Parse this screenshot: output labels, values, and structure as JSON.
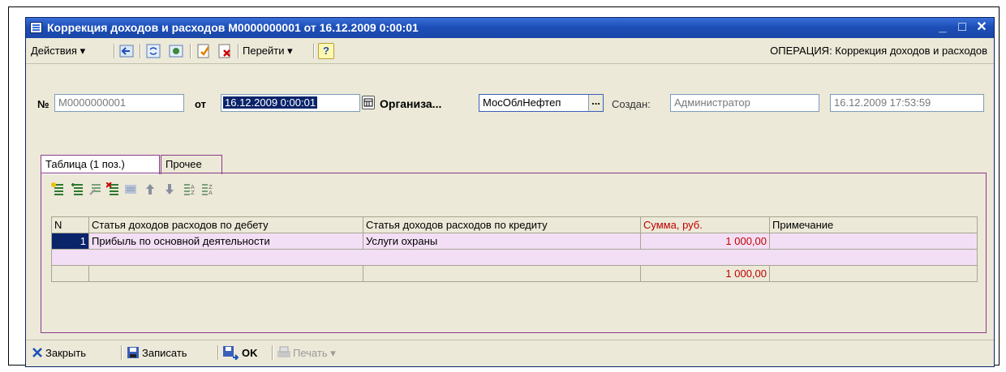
{
  "window": {
    "title": "Коррекция доходов и расходов М0000000001 от 16.12.2009 0:00:01",
    "minimize": "_",
    "maximize": "□",
    "close": "✕"
  },
  "toolbar": {
    "actions_label": "Действия ▾",
    "goto_label": "Перейти ▾",
    "help_label": "?",
    "operation_label": "ОПЕРАЦИЯ: Коррекция доходов и расходов"
  },
  "header": {
    "number_label": "№",
    "number_value": "М0000000001",
    "date_label": "от",
    "date_value": "16.12.2009  0:00:01",
    "org_label": "Организа...",
    "org_value": "МосОблНефтеп",
    "org_button": "...",
    "created_label": "Создан:",
    "created_value": "Администратор",
    "created_date": "16.12.2009 17:53:59"
  },
  "tabs": [
    {
      "label": "Таблица (1 поз.)"
    },
    {
      "label": "Прочее"
    }
  ],
  "table": {
    "columns": [
      "N",
      "Статья доходов расходов по дебету",
      "Статья доходов расходов по кредиту",
      "Сумма, руб.",
      "Примечание"
    ],
    "rows": [
      {
        "n": "1",
        "debit": "Прибыль по основной деятельности",
        "credit": "Услуги охраны",
        "sum": "1 000,00",
        "note": ""
      }
    ],
    "total_sum": "1 000,00"
  },
  "footer": {
    "close_label": "Закрыть",
    "save_label": "Записать",
    "ok_label": "OK",
    "print_label": "Печать ▾"
  },
  "colors": {
    "title_bar": "#1d4fb8",
    "window_bg": "#ece9d8",
    "row_highlight": "#f3dff5",
    "sum_header": "#c00000"
  }
}
